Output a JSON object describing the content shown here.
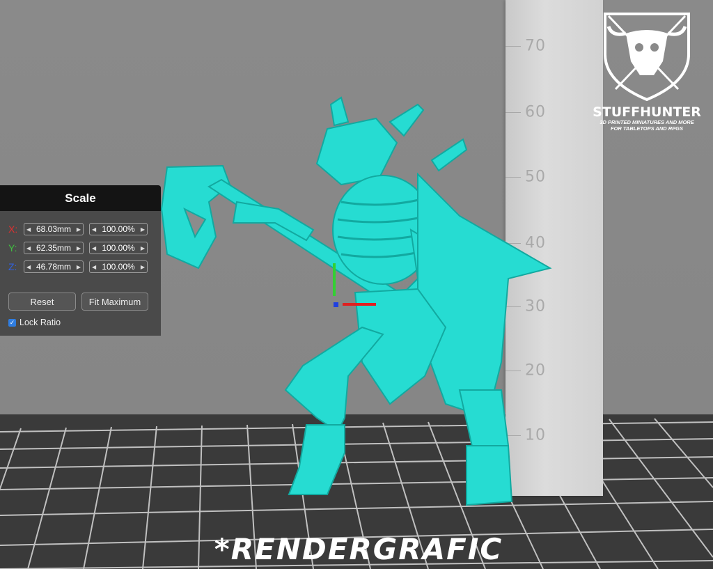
{
  "scale_panel": {
    "title": "Scale",
    "x": {
      "label": "X:",
      "mm": "68.03mm",
      "pct": "100.00%",
      "color": "#e03030"
    },
    "y": {
      "label": "Y:",
      "mm": "62.35mm",
      "pct": "100.00%",
      "color": "#40c040"
    },
    "z": {
      "label": "Z:",
      "mm": "46.78mm",
      "pct": "100.00%",
      "color": "#3060e0"
    },
    "reset_label": "Reset",
    "fit_label": "Fit Maximum",
    "lock_label": "Lock Ratio",
    "lock_checked": true
  },
  "ruler": {
    "marks": [
      "70",
      "60",
      "50",
      "40",
      "30",
      "20",
      "10"
    ]
  },
  "logo": {
    "title": "STUFFHUNTER",
    "sub1": "3D PRINTED MINIATURES AND MORE",
    "sub2": "FOR TABLETOPS AND RPGS"
  },
  "watermark": "*RENDERGRAFIC",
  "colors": {
    "model": "#26dcd2",
    "panel_bg": "#4a4a4a",
    "panel_header": "#141414",
    "checkbox": "#2f7de0"
  }
}
